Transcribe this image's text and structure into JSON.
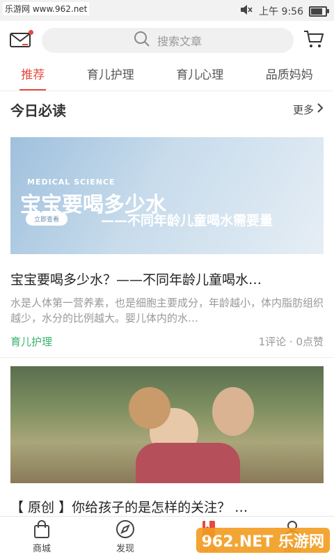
{
  "status_bar": {
    "watermark": "乐游网 www.962.net",
    "time": "上午 9:56"
  },
  "header": {
    "search_placeholder": "搜索文章"
  },
  "tabs": [
    {
      "label": "推荐",
      "active": true
    },
    {
      "label": "育儿护理",
      "active": false
    },
    {
      "label": "育儿心理",
      "active": false
    },
    {
      "label": "品质妈妈",
      "active": false
    }
  ],
  "section": {
    "title": "今日必读",
    "more": "更多"
  },
  "article1": {
    "banner_label": "MEDICAL SCIENCE",
    "banner_title": "宝宝要喝多少水",
    "banner_button": "立即查看",
    "banner_subtitle": "——不同年龄儿童喝水需要量",
    "title": "宝宝要喝多少水？——不同年龄儿童喝水…",
    "desc": "水是人体第一营养素，也是细胞主要成分，年龄越小，体内脂肪组织越少，水分的比例越大。婴儿体内的水…",
    "category": "育儿护理",
    "stats": "1评论 · 0点赞"
  },
  "article2": {
    "title": "【 原创 】你给孩子的是怎样的关注？ …"
  },
  "bottom_nav": [
    {
      "label": "商城",
      "icon": "bag-icon"
    },
    {
      "label": "发现",
      "icon": "compass-icon"
    },
    {
      "label": "阅读",
      "icon": "book-icon",
      "active": true
    },
    {
      "label": "我的",
      "icon": "user-icon"
    }
  ],
  "watermark_bottom": "962.NET 乐游网",
  "colors": {
    "accent": "#e8483e",
    "category": "#3cb371"
  }
}
